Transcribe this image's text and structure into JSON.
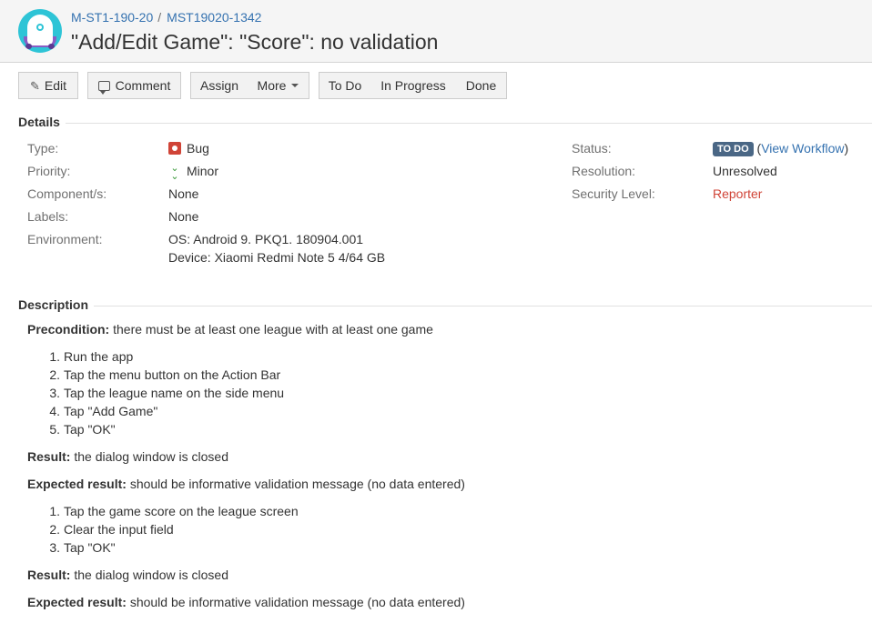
{
  "header": {
    "breadcrumb_project": "M-ST1-190-20",
    "breadcrumb_separator": "/",
    "breadcrumb_issue": "MST19020-1342",
    "title": "\"Add/Edit Game\": \"Score\": no validation"
  },
  "toolbar": {
    "edit": "Edit",
    "comment": "Comment",
    "assign": "Assign",
    "more": "More",
    "todo": "To Do",
    "in_progress": "In Progress",
    "done": "Done"
  },
  "details": {
    "heading": "Details",
    "type_label": "Type:",
    "type_value": "Bug",
    "priority_label": "Priority:",
    "priority_value": "Minor",
    "components_label": "Component/s:",
    "components_value": "None",
    "labels_label": "Labels:",
    "labels_value": "None",
    "environment_label": "Environment:",
    "environment_line1": "OS: Android 9. PKQ1. 180904.001",
    "environment_line2": "Device: Xiaomi Redmi Note 5 4/64 GB",
    "status_label": "Status:",
    "status_value": "TO DO",
    "view_workflow_open": "(",
    "view_workflow": "View Workflow",
    "view_workflow_close": ")",
    "resolution_label": "Resolution:",
    "resolution_value": "Unresolved",
    "security_label": "Security Level:",
    "security_value": "Reporter"
  },
  "description": {
    "heading": "Description",
    "precondition_label": "Precondition:",
    "precondition_text": " there must be at least one league with at least one game",
    "steps1": [
      {
        "num": "1.",
        "text": "Run the app"
      },
      {
        "num": "2.",
        "text": "Tap the menu button on the Action Bar"
      },
      {
        "num": "3.",
        "text": "Tap the league name on the side menu"
      },
      {
        "num": "4.",
        "text": "Tap \"Add Game\""
      },
      {
        "num": "5.",
        "text": "Tap \"OK\""
      }
    ],
    "result1_label": "Result:",
    "result1_text": " the dialog window is closed",
    "expected1_label": "Expected result:",
    "expected1_text": " should be informative validation message (no data entered)",
    "steps2": [
      {
        "num": "1.",
        "text": "Tap the game score on the league screen"
      },
      {
        "num": "2.",
        "text": "Clear the input field"
      },
      {
        "num": "3.",
        "text": "Tap \"OK\""
      }
    ],
    "result2_label": "Result:",
    "result2_text": " the dialog window is closed",
    "expected2_label": "Expected result:",
    "expected2_text": " should be informative validation message (no data entered)"
  }
}
